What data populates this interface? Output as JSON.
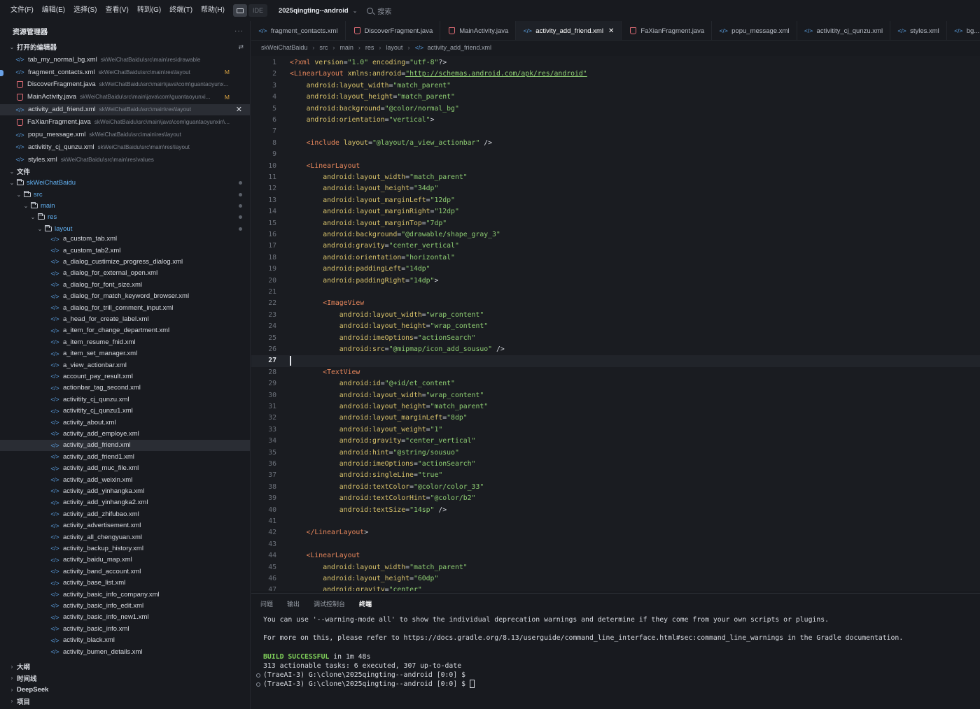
{
  "menu": [
    "文件(F)",
    "编辑(E)",
    "选择(S)",
    "查看(V)",
    "转到(G)",
    "终端(T)",
    "帮助(H)"
  ],
  "ide_label": "IDE",
  "project": "2025qingting--android",
  "search_placeholder": "搜索",
  "sidebar": {
    "title": "资源管理器",
    "more": "···",
    "open_editors_label": "打开的编辑器",
    "open_editors": [
      {
        "name": "tab_my_normal_bg.xml",
        "path": "skWeiChatBaidu\\src\\main\\res\\drawable",
        "type": "xml",
        "modified": false
      },
      {
        "name": "fragment_contacts.xml",
        "path": "skWeiChatBaidu\\src\\main\\res\\layout",
        "type": "xml",
        "modified": true
      },
      {
        "name": "DiscoverFragment.java",
        "path": "skWeiChatBaidu\\src\\main\\java\\com\\guantaoyunx...",
        "type": "java",
        "modified": false
      },
      {
        "name": "MainActivity.java",
        "path": "skWeiChatBaidu\\src\\main\\java\\com\\guantaoyunxi...",
        "type": "java",
        "modified": true
      },
      {
        "name": "activity_add_friend.xml",
        "path": "skWeiChatBaidu\\src\\main\\res\\layout",
        "type": "xml",
        "modified": false,
        "active": true
      },
      {
        "name": "FaXianFragment.java",
        "path": "skWeiChatBaidu\\src\\main\\java\\com\\guantaoyunxin\\...",
        "type": "java",
        "modified": false
      },
      {
        "name": "popu_message.xml",
        "path": "skWeiChatBaidu\\src\\main\\res\\layout",
        "type": "xml",
        "modified": false
      },
      {
        "name": "activitity_cj_qunzu.xml",
        "path": "skWeiChatBaidu\\src\\main\\res\\layout",
        "type": "xml",
        "modified": false
      },
      {
        "name": "styles.xml",
        "path": "skWeiChatBaidu\\src\\main\\res\\values",
        "type": "xml",
        "modified": false
      }
    ],
    "modified_marker": "M",
    "files_label": "文件",
    "tree": [
      "skWeiChatBaidu",
      "src",
      "main",
      "res",
      "layout"
    ],
    "layout_files": [
      "a_custom_tab.xml",
      "a_custom_tab2.xml",
      "a_dialog_custimize_progress_dialog.xml",
      "a_dialog_for_external_open.xml",
      "a_dialog_for_font_size.xml",
      "a_dialog_for_match_keyword_browser.xml",
      "a_dialog_for_trill_comment_input.xml",
      "a_head_for_create_label.xml",
      "a_item_for_change_department.xml",
      "a_item_resume_fnid.xml",
      "a_item_set_manager.xml",
      "a_view_actionbar.xml",
      "account_pay_result.xml",
      "actionbar_tag_second.xml",
      "activitity_cj_qunzu.xml",
      "activitity_cj_qunzu1.xml",
      "activity_about.xml",
      "activity_add_employe.xml",
      "activity_add_friend.xml",
      "activity_add_friend1.xml",
      "activity_add_muc_file.xml",
      "activity_add_weixin.xml",
      "activity_add_yinhangka.xml",
      "activity_add_yinhangka2.xml",
      "activity_add_zhifubao.xml",
      "activity_advertisement.xml",
      "activity_all_chengyuan.xml",
      "activity_backup_history.xml",
      "activity_baidu_map.xml",
      "activity_band_account.xml",
      "activity_base_list.xml",
      "activity_basic_info_company.xml",
      "activity_basic_info_edit.xml",
      "activity_basic_info_new1.xml",
      "activity_basic_info.xml",
      "activity_black.xml",
      "activity_bumen_details.xml"
    ],
    "bottom_sections": [
      "大纲",
      "时间线",
      "DeepSeek",
      "项目"
    ]
  },
  "tabs": [
    "fragment_contacts.xml",
    "DiscoverFragment.java",
    "MainActivity.java",
    "activity_add_friend.xml",
    "FaXianFragment.java",
    "popu_message.xml",
    "activitity_cj_qunzu.xml",
    "styles.xml",
    "bg..."
  ],
  "tab_types": [
    "xml",
    "java",
    "java",
    "xml",
    "java",
    "xml",
    "xml",
    "xml",
    "xml"
  ],
  "active_tab": 3,
  "breadcrumb": [
    "skWeiChatBaidu",
    "src",
    "main",
    "res",
    "layout",
    "activity_add_friend.xml"
  ],
  "current_line": 27,
  "code_lines": [
    "<?xml version=\"1.0\" encoding=\"utf-8\"?>",
    "<LinearLayout xmlns:android=\"http://schemas.android.com/apk/res/android\"",
    "    android:layout_width=\"match_parent\"",
    "    android:layout_height=\"match_parent\"",
    "    android:background=\"@color/normal_bg\"",
    "    android:orientation=\"vertical\">",
    "",
    "    <include layout=\"@layout/a_view_actionbar\" />",
    "",
    "    <LinearLayout",
    "        android:layout_width=\"match_parent\"",
    "        android:layout_height=\"34dp\"",
    "        android:layout_marginLeft=\"12dp\"",
    "        android:layout_marginRight=\"12dp\"",
    "        android:layout_marginTop=\"7dp\"",
    "        android:background=\"@drawable/shape_gray_3\"",
    "        android:gravity=\"center_vertical\"",
    "        android:orientation=\"horizontal\"",
    "        android:paddingLeft=\"14dp\"",
    "        android:paddingRight=\"14dp\">",
    "",
    "        <ImageView",
    "            android:layout_width=\"wrap_content\"",
    "            android:layout_height=\"wrap_content\"",
    "            android:imeOptions=\"actionSearch\"",
    "            android:src=\"@mipmap/icon_add_sousuo\" />",
    "",
    "        <TextView",
    "            android:id=\"@+id/et_content\"",
    "            android:layout_width=\"wrap_content\"",
    "            android:layout_height=\"match_parent\"",
    "            android:layout_marginLeft=\"8dp\"",
    "            android:layout_weight=\"1\"",
    "            android:gravity=\"center_vertical\"",
    "            android:hint=\"@string/sousuo\"",
    "            android:imeOptions=\"actionSearch\"",
    "            android:singleLine=\"true\"",
    "            android:textColor=\"@color/color_33\"",
    "            android:textColorHint=\"@color/b2\"",
    "            android:textSize=\"14sp\" />",
    "",
    "    </LinearLayout>",
    "",
    "    <LinearLayout",
    "        android:layout_width=\"match_parent\"",
    "        android:layout_height=\"60dp\"",
    "        android:gravity=\"center\""
  ],
  "panel": {
    "tabs": [
      "问题",
      "输出",
      "调试控制台",
      "终端"
    ],
    "active_tab": 3,
    "lines": [
      "You can use '--warning-mode all' to show the individual deprecation warnings and determine if they come from your own scripts or plugins.",
      "",
      "For more on this, please refer to https://docs.gradle.org/8.13/userguide/command_line_interface.html#sec:command_line_warnings in the Gradle documentation.",
      ""
    ],
    "build_status": "BUILD SUCCESSFUL",
    "build_time": " in 1m 48s",
    "tasks_line": "313 actionable tasks: 6 executed, 307 up-to-date",
    "prompts": [
      "(TraeAI-3) G:\\clone\\2025qingting--android [0:0] $",
      "(TraeAI-3) G:\\clone\\2025qingting--android [0:0] $ "
    ]
  },
  "colors": {
    "tag": "#e8875c",
    "attr": "#d9c36b",
    "value": "#8fce73",
    "xml_icon": "#5da3e6",
    "java_icon": "#e06c75",
    "build_ok": "#7fd05a"
  }
}
